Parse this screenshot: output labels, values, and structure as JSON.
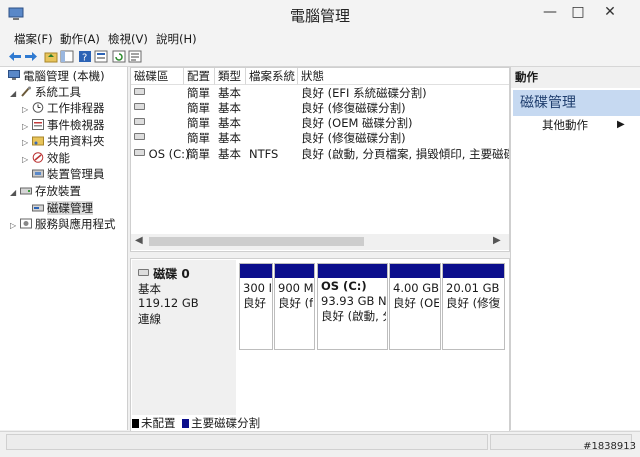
{
  "window": {
    "title": "電腦管理"
  },
  "menu": [
    "檔案(F)",
    "動作(A)",
    "檢視(V)",
    "說明(H)"
  ],
  "toolbar": {
    "icons": [
      "back-arrow-icon",
      "forward-arrow-icon",
      "up-folder-icon",
      "show-tree-icon",
      "help-icon",
      "properties-icon",
      "refresh-icon",
      "export-icon"
    ]
  },
  "tree": {
    "root": "電腦管理 (本機)",
    "system_tools": "系統工具",
    "task_scheduler": "工作排程器",
    "event_viewer": "事件檢視器",
    "shared_folders": "共用資料夾",
    "performance": "效能",
    "device_manager": "裝置管理員",
    "storage": "存放裝置",
    "disk_management": "磁碟管理",
    "services_apps": "服務與應用程式"
  },
  "volumes": {
    "columns": [
      "磁碟區",
      "配置",
      "類型",
      "檔案系統",
      "狀態"
    ],
    "rows": [
      {
        "name": "",
        "layout": "簡單",
        "type": "基本",
        "fs": "",
        "status": "良好 (EFI 系統磁碟分割)"
      },
      {
        "name": "",
        "layout": "簡單",
        "type": "基本",
        "fs": "",
        "status": "良好 (修復磁碟分割)"
      },
      {
        "name": "",
        "layout": "簡單",
        "type": "基本",
        "fs": "",
        "status": "良好 (OEM 磁碟分割)"
      },
      {
        "name": "",
        "layout": "簡單",
        "type": "基本",
        "fs": "",
        "status": "良好 (修復磁碟分割)"
      },
      {
        "name": "OS (C:)",
        "layout": "簡單",
        "type": "基本",
        "fs": "NTFS",
        "status": "良好 (啟動, 分頁檔案, 損毀傾印, 主要磁碟"
      }
    ]
  },
  "disk": {
    "name": "磁碟 0",
    "type": "基本",
    "size": "119.12 GB",
    "status": "連線",
    "partitions": [
      {
        "title": "",
        "size": "300 M",
        "status": "良好"
      },
      {
        "title": "",
        "size": "900 M",
        "status": "良好 (f"
      },
      {
        "title": "OS  (C:)",
        "size": "93.93 GB NT",
        "status": "良好 (啟動, 分"
      },
      {
        "title": "",
        "size": "4.00 GB",
        "status": "良好 (OE"
      },
      {
        "title": "",
        "size": "20.01 GB",
        "status": "良好 (修復"
      }
    ]
  },
  "legend": {
    "unallocated": "未配置",
    "primary": "主要磁碟分割",
    "unallocated_color": "#000000",
    "primary_color": "#0b0e8c"
  },
  "actions": {
    "header": "動作",
    "section": "磁碟管理",
    "more": "其他動作"
  },
  "watermark": "#1838913",
  "colors": {
    "accent": "#c6d9f1",
    "partition_bar": "#0b0e8c"
  }
}
